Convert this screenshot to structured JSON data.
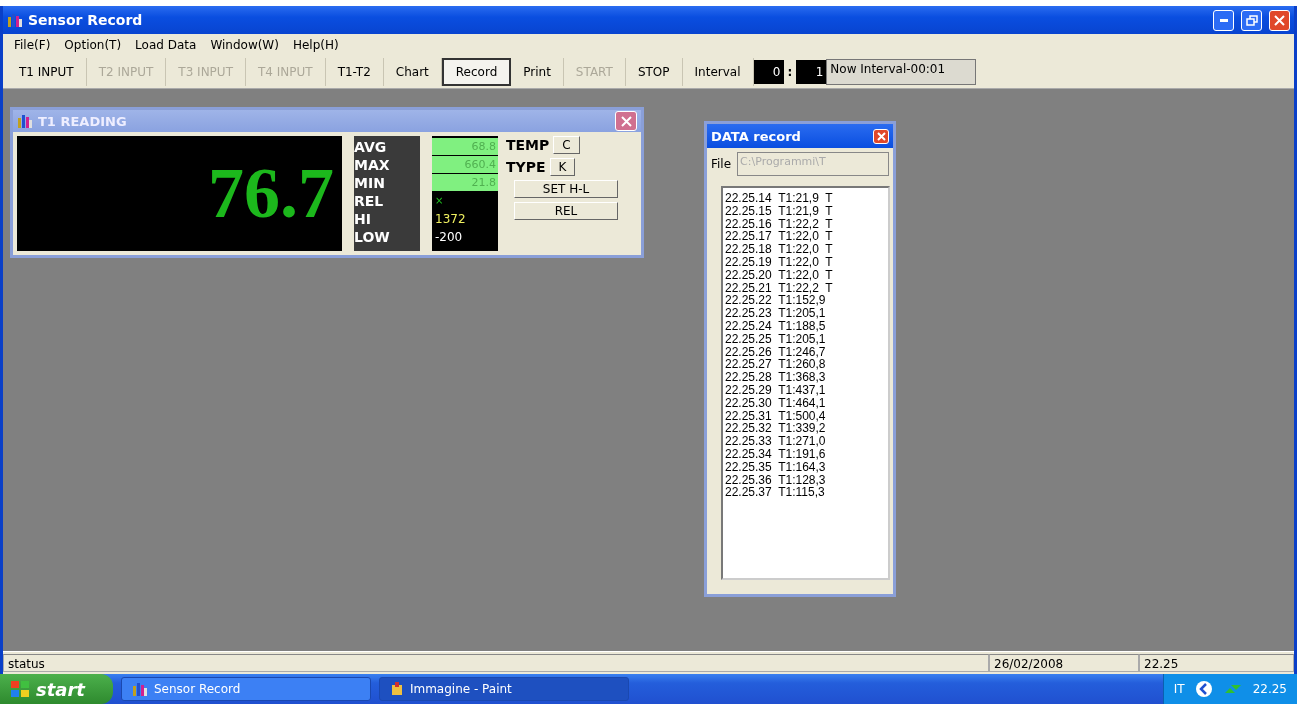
{
  "window": {
    "title": "Sensor Record"
  },
  "menu": [
    "File(F)",
    "Option(T)",
    "Load Data",
    "Window(W)",
    "Help(H)"
  ],
  "toolbar": [
    {
      "label": "T1 INPUT",
      "disabled": false,
      "selected": false
    },
    {
      "label": "T2 INPUT",
      "disabled": true,
      "selected": false
    },
    {
      "label": "T3 INPUT",
      "disabled": true,
      "selected": false
    },
    {
      "label": "T4 INPUT",
      "disabled": true,
      "selected": false
    },
    {
      "label": "T1-T2",
      "disabled": false,
      "selected": false
    },
    {
      "label": "Chart",
      "disabled": false,
      "selected": false
    },
    {
      "label": "Record",
      "disabled": false,
      "selected": true
    },
    {
      "label": "Print",
      "disabled": false,
      "selected": false
    },
    {
      "label": "START",
      "disabled": true,
      "selected": false
    },
    {
      "label": "STOP",
      "disabled": false,
      "selected": false
    },
    {
      "label": "Interval",
      "disabled": false,
      "selected": false
    }
  ],
  "interval": {
    "minutes": "0",
    "separator": ":",
    "seconds": "1",
    "now": "Now Interval-00:01"
  },
  "reading_window": {
    "title": "T1 READING",
    "value": "76.7",
    "stats": [
      {
        "label": "AVG",
        "kind": "box",
        "value": "68.8"
      },
      {
        "label": "MAX",
        "kind": "box",
        "value": "660.4"
      },
      {
        "label": "MIN",
        "kind": "box",
        "value": "21.8"
      },
      {
        "label": "REL",
        "kind": "mark",
        "value": "×"
      },
      {
        "label": "HI",
        "kind": "text",
        "value": "1372",
        "color": "#f0f060"
      },
      {
        "label": "LOW",
        "kind": "text",
        "value": "-200",
        "color": "#ffffff"
      }
    ],
    "temp_label": "TEMP",
    "temp_unit": "C",
    "type_label": "TYPE",
    "type_value": "K",
    "buttons": [
      "SET H-L",
      "REL"
    ]
  },
  "record_window": {
    "title": "DATA record",
    "file_label": "File",
    "file_path": "C:\\Programmi\\T",
    "lines": [
      "22.25.14  T1:21,9  T",
      "22.25.15  T1:21,9  T",
      "22.25.16  T1:22,2  T",
      "22.25.17  T1:22,0  T",
      "22.25.18  T1:22,0  T",
      "22.25.19  T1:22,0  T",
      "22.25.20  T1:22,0  T",
      "22.25.21  T1:22,2  T",
      "22.25.22  T1:152,9",
      "22.25.23  T1:205,1",
      "22.25.24  T1:188,5",
      "22.25.25  T1:205,1",
      "22.25.26  T1:246,7",
      "22.25.27  T1:260,8",
      "22.25.28  T1:368,3",
      "22.25.29  T1:437,1",
      "22.25.30  T1:464,1",
      "22.25.31  T1:500,4",
      "22.25.32  T1:339,2",
      "22.25.33  T1:271,0",
      "22.25.34  T1:191,6",
      "22.25.35  T1:164,3",
      "22.25.36  T1:128,3",
      "22.25.37  T1:115,3"
    ]
  },
  "status_bar": [
    "status",
    "26/02/2008",
    "22.25"
  ],
  "taskbar": {
    "start": "start",
    "tasks": [
      {
        "label": "Sensor Record",
        "selected": false
      },
      {
        "label": "Immagine - Paint",
        "selected": true
      }
    ],
    "language": "IT",
    "clock": "22.25"
  }
}
